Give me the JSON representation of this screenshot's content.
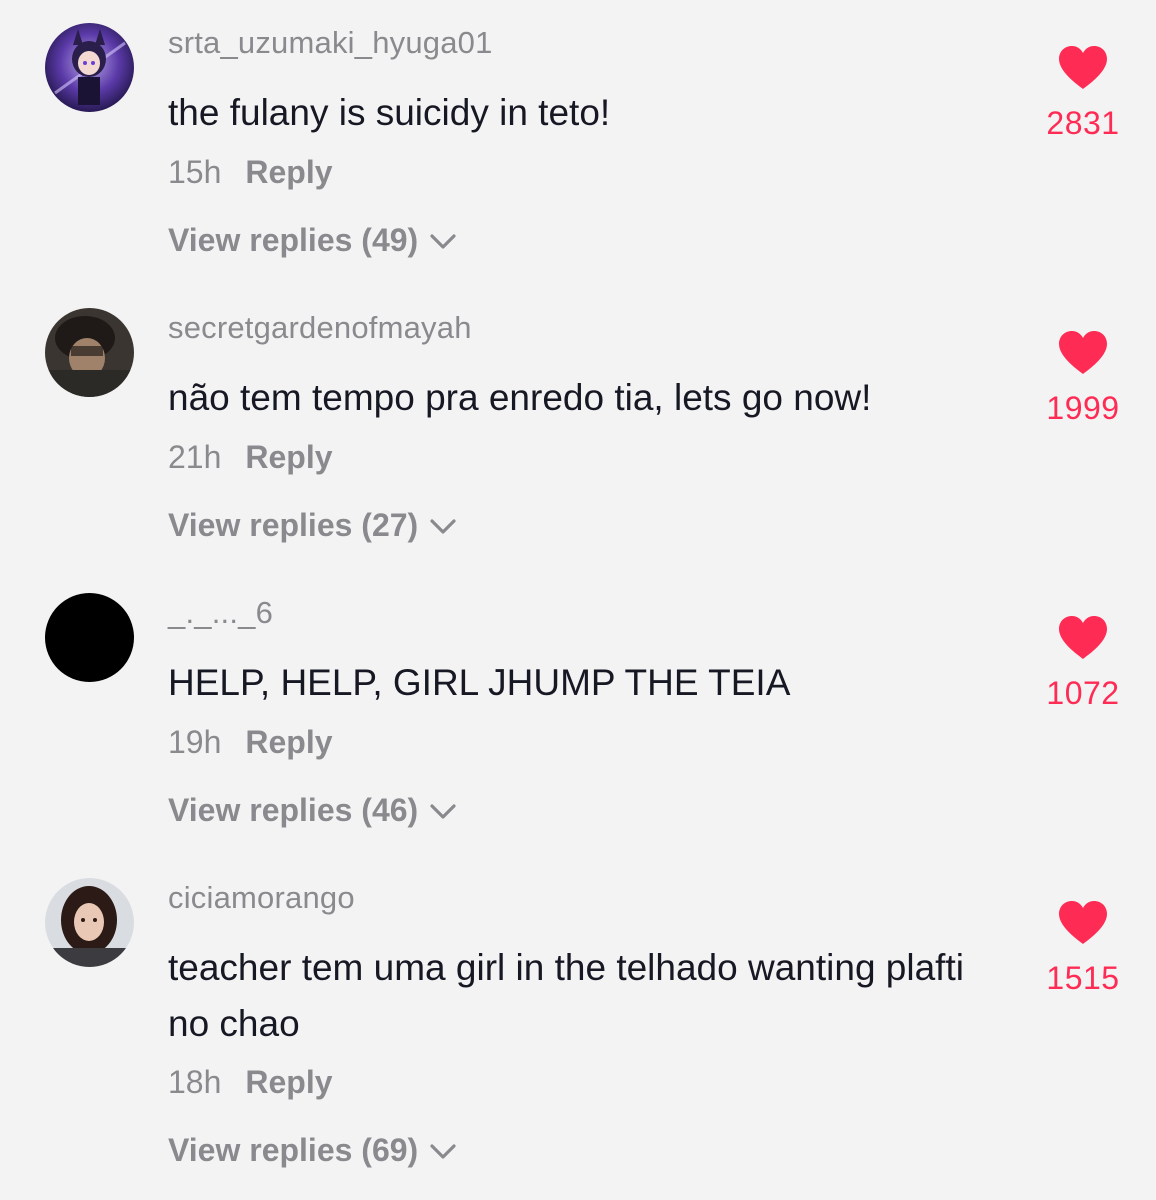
{
  "colors": {
    "background": "#f4f3f4",
    "text": "#161823",
    "muted": "#8a8a8e",
    "like": "#fe2c55"
  },
  "comments": [
    {
      "username": "srta_uzumaki_hyuga01",
      "text": "the fulany is suicidy in teto!",
      "time": "15h",
      "reply_label": "Reply",
      "view_replies": "View replies (49)",
      "likes": "2831",
      "avatar": "anime-character-avatar"
    },
    {
      "username": "secretgardenofmayah",
      "text": "não tem tempo pra enredo tia, lets go now!",
      "time": "21h",
      "reply_label": "Reply",
      "view_replies": "View replies (27)",
      "likes": "1999",
      "avatar": "photo-avatar"
    },
    {
      "username": "_._..._6",
      "text": "HELP, HELP, GIRL JHUMP THE TEIA",
      "time": "19h",
      "reply_label": "Reply",
      "view_replies": "View replies (46)",
      "likes": "1072",
      "avatar": "black-avatar"
    },
    {
      "username": "ciciamorango",
      "text": "teacher tem uma girl in the telhado wanting plafti no chao",
      "time": "18h",
      "reply_label": "Reply",
      "view_replies": "View replies (69)",
      "likes": "1515",
      "avatar": "selfie-avatar"
    }
  ]
}
